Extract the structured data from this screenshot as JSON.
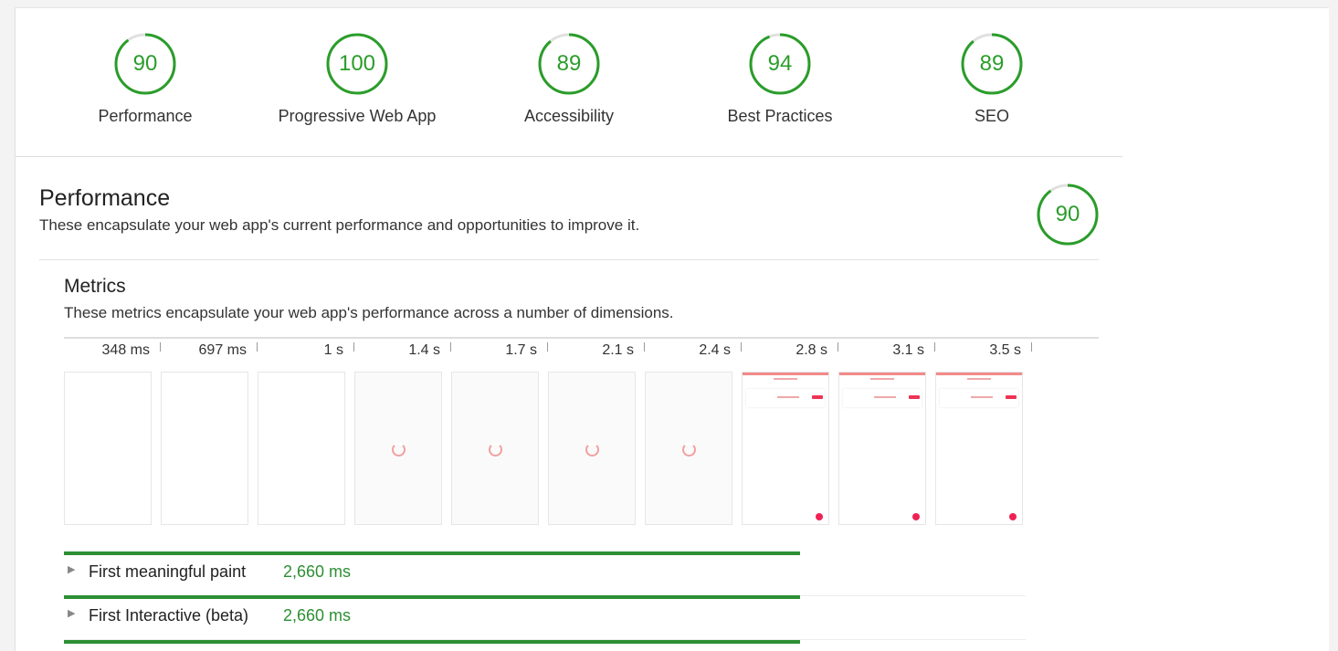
{
  "categories": [
    {
      "label": "Performance",
      "score": "90",
      "fraction": 0.9
    },
    {
      "label": "Progressive Web App",
      "score": "100",
      "fraction": 1.0
    },
    {
      "label": "Accessibility",
      "score": "89",
      "fraction": 0.89
    },
    {
      "label": "Best Practices",
      "score": "94",
      "fraction": 0.94
    },
    {
      "label": "SEO",
      "score": "89",
      "fraction": 0.89
    }
  ],
  "performance": {
    "title": "Performance",
    "description": "These encapsulate your web app's current performance and opportunities to improve it.",
    "score": "90",
    "fraction": 0.9
  },
  "metrics": {
    "title": "Metrics",
    "description": "These metrics encapsulate your web app's performance across a number of dimensions.",
    "filmstrip": [
      {
        "time": "348 ms",
        "state": "blank"
      },
      {
        "time": "697 ms",
        "state": "blank"
      },
      {
        "time": "1 s",
        "state": "blank"
      },
      {
        "time": "1.4 s",
        "state": "loading"
      },
      {
        "time": "1.7 s",
        "state": "loading"
      },
      {
        "time": "2.1 s",
        "state": "loading"
      },
      {
        "time": "2.4 s",
        "state": "loading"
      },
      {
        "time": "2.8 s",
        "state": "loaded"
      },
      {
        "time": "3.1 s",
        "state": "loaded"
      },
      {
        "time": "3.5 s",
        "state": "loaded"
      }
    ],
    "items": [
      {
        "name": "First meaningful paint",
        "value": "2,660 ms"
      },
      {
        "name": "First Interactive (beta)",
        "value": "2,660 ms"
      }
    ]
  },
  "colors": {
    "pass": "#2d8f34",
    "gauge_track": "#e0e0e0"
  }
}
